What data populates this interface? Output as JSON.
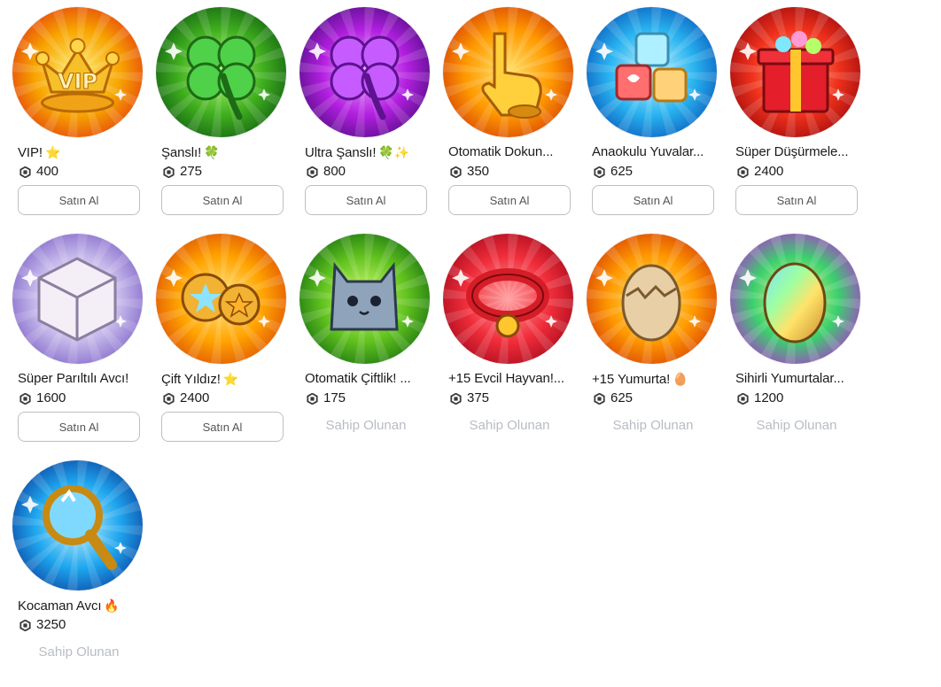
{
  "items": [
    {
      "title": "VIP!",
      "emoji": "⭐",
      "price": "400",
      "status": "buy",
      "action": "Satın Al",
      "icon": "vip-crown-icon",
      "bg": [
        "#fff27a",
        "#f7a400",
        "#e3380f"
      ]
    },
    {
      "title": "Şanslı!",
      "emoji": "🍀",
      "price": "275",
      "status": "buy",
      "action": "Satın Al",
      "icon": "four-leaf-clover-icon",
      "bg": [
        "#b9ff74",
        "#3fae1e",
        "#0f5a12"
      ]
    },
    {
      "title": "Ultra Şanslı!",
      "emoji": "🍀✨",
      "price": "800",
      "status": "buy",
      "action": "Satın Al",
      "icon": "ultra-clover-icon",
      "bg": [
        "#f0a9ff",
        "#b21fe0",
        "#4a0c7c"
      ]
    },
    {
      "title": "Otomatik Dokun...",
      "emoji": "",
      "price": "350",
      "status": "buy",
      "action": "Satın Al",
      "icon": "tap-hand-icon",
      "bg": [
        "#ffe36a",
        "#ff9900",
        "#d33b06"
      ]
    },
    {
      "title": "Anaokulu Yuvalar...",
      "emoji": "",
      "price": "625",
      "status": "buy",
      "action": "Satın Al",
      "icon": "toy-blocks-icon",
      "bg": [
        "#c9f6ff",
        "#29b3f0",
        "#0755b8"
      ]
    },
    {
      "title": "Süper Düşürmele...",
      "emoji": "",
      "price": "2400",
      "status": "buy",
      "action": "Satın Al",
      "icon": "gift-box-icon",
      "bg": [
        "#ffb38a",
        "#f0321c",
        "#99070c"
      ]
    },
    {
      "title": "Süper Parıltılı Avcı!",
      "emoji": "",
      "price": "1600",
      "status": "buy",
      "action": "Satın Al",
      "icon": "shiny-dice-icon",
      "bg": [
        "#ffffff",
        "#c4b8ea",
        "#7c5fc6"
      ]
    },
    {
      "title": "Çift Yıldız!",
      "emoji": "⭐",
      "price": "2400",
      "status": "buy",
      "action": "Satın Al",
      "icon": "double-star-icon",
      "bg": [
        "#ffe987",
        "#ffa300",
        "#db4a05"
      ]
    },
    {
      "title": "Otomatik Çiftlik! ...",
      "emoji": "",
      "price": "175",
      "status": "owned",
      "action": "Sahip Olunan",
      "icon": "cat-pet-icon",
      "bg": [
        "#d6ff73",
        "#61c21e",
        "#146b10"
      ]
    },
    {
      "title": "+15 Evcil Hayvan!...",
      "emoji": "",
      "price": "375",
      "status": "owned",
      "action": "Sahip Olunan",
      "icon": "pet-collar-icon",
      "bg": [
        "#ffa2a2",
        "#f02d3b",
        "#a3081a"
      ]
    },
    {
      "title": "+15 Yumurta!",
      "emoji": "🥚",
      "price": "625",
      "status": "owned",
      "action": "Sahip Olunan",
      "icon": "cracked-egg-icon",
      "bg": [
        "#ffe873",
        "#ff9a00",
        "#d63b06"
      ]
    },
    {
      "title": "Sihirli Yumurtalar...",
      "emoji": "",
      "price": "1200",
      "status": "owned",
      "action": "Sahip Olunan",
      "icon": "rainbow-egg-icon",
      "bg": [
        "#fff68a",
        "#3bd06c",
        "#b62ad8"
      ]
    },
    {
      "title": "Kocaman Avcı",
      "emoji": "🔥",
      "price": "3250",
      "status": "owned",
      "action": "Sahip Olunan",
      "icon": "magnifier-icon",
      "bg": [
        "#c6f2ff",
        "#1ea6ee",
        "#0b3f9e"
      ]
    }
  ]
}
